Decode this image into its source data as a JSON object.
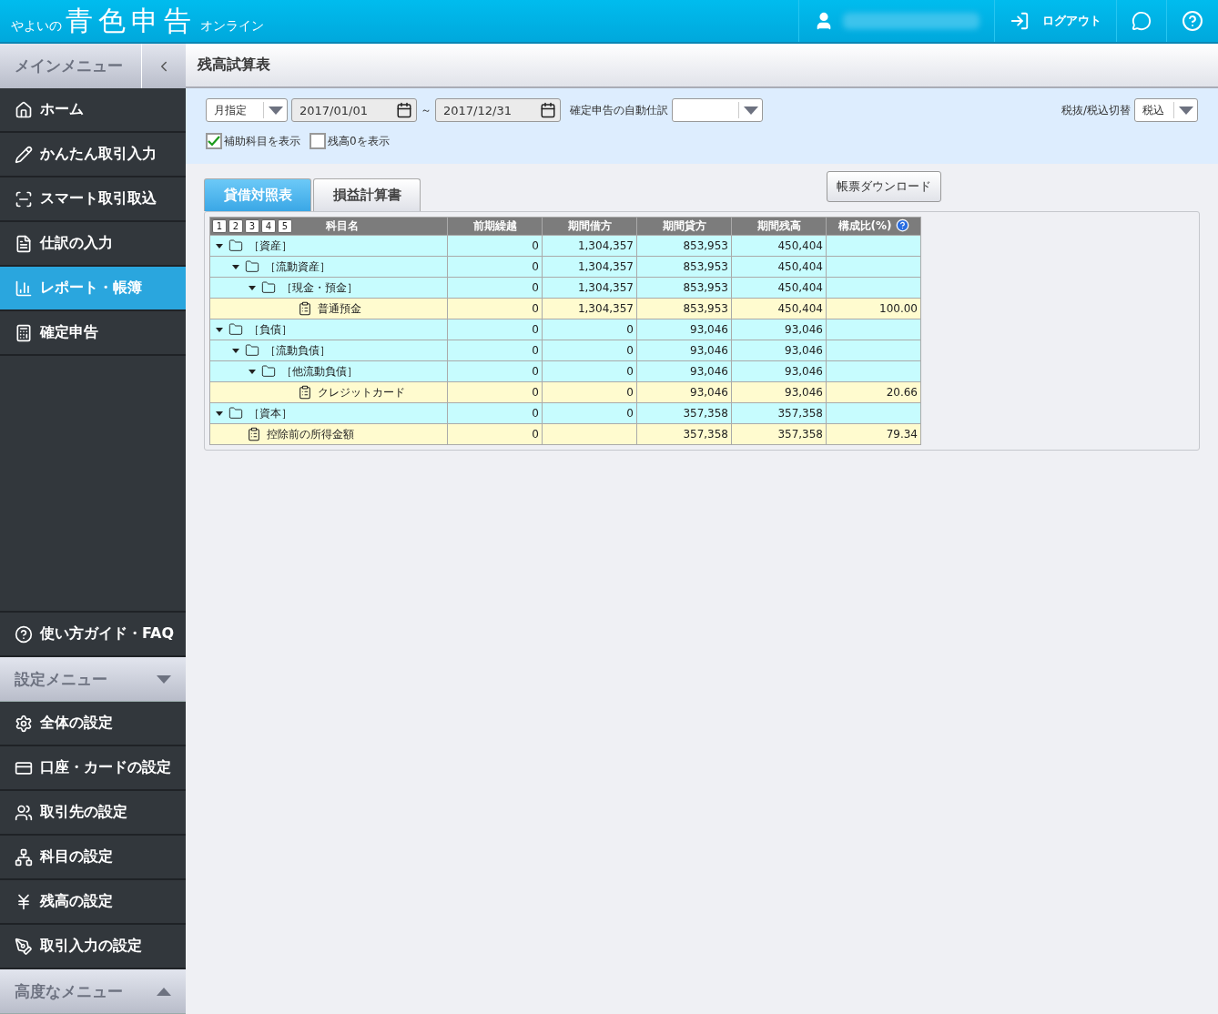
{
  "header": {
    "logo": {
      "prefix": "やよいの",
      "main": "青色申告",
      "suffix": "オンライン"
    },
    "logout": "ログアウト"
  },
  "sidebar": {
    "main_menu": {
      "title": "メインメニュー"
    },
    "items": [
      {
        "label": "ホーム",
        "selected": false
      },
      {
        "label": "かんたん取引入力",
        "selected": false
      },
      {
        "label": "スマート取引取込",
        "selected": false
      },
      {
        "label": "仕訳の入力",
        "selected": false
      },
      {
        "label": "レポート・帳簿",
        "selected": true
      },
      {
        "label": "確定申告",
        "selected": false
      }
    ],
    "guide": "使い方ガイド・FAQ",
    "settings_menu": {
      "title": "設定メニュー",
      "expanded": true,
      "items": [
        "全体の設定",
        "口座・カードの設定",
        "取引先の設定",
        "科目の設定",
        "残高の設定",
        "取引入力の設定"
      ]
    },
    "advanced_menu": {
      "title": "高度なメニュー",
      "expanded": false
    }
  },
  "page_title": "残高試算表",
  "filters": {
    "period_mode": "月指定",
    "date_from": "2017/01/01",
    "range_sep": "～",
    "date_to": "2017/12/31",
    "auto_journal_label": "確定申告の自動仕訳",
    "tax_label": "税抜/税込切替",
    "tax_mode": "税込",
    "checkboxes": [
      {
        "label": "補助科目を表示",
        "checked": true
      },
      {
        "label": "残高0を表示",
        "checked": false
      }
    ]
  },
  "tabs": [
    {
      "label": "貸借対照表",
      "selected": true
    },
    {
      "label": "損益計算書",
      "selected": false
    }
  ],
  "download_button": "帳票ダウンロード",
  "table": {
    "level_buttons": [
      "1",
      "2",
      "3",
      "4",
      "5"
    ],
    "columns": [
      "科目名",
      "前期繰越",
      "期間借方",
      "期間貸方",
      "期間残高",
      "構成比(%)"
    ],
    "rows": [
      {
        "kind": "folder",
        "name": "［資産］",
        "expanded": true,
        "values": [
          "0",
          "1,304,357",
          "853,953",
          "450,404"
        ],
        "children": [
          {
            "kind": "folder",
            "name": "［流動資産］",
            "expanded": true,
            "values": [
              "0",
              "1,304,357",
              "853,953",
              "450,404"
            ],
            "children": [
              {
                "kind": "folder",
                "name": "［現金・預金］",
                "expanded": true,
                "values": [
                  "0",
                  "1,304,357",
                  "853,953",
                  "450,404"
                ],
                "children": [
                  {
                    "kind": "account",
                    "name": "普通預金",
                    "values": [
                      "0",
                      "1,304,357",
                      "853,953",
                      "450,404",
                      "100.00"
                    ]
                  }
                ]
              }
            ]
          }
        ]
      },
      {
        "kind": "folder",
        "name": "［負債］",
        "expanded": true,
        "values": [
          "0",
          "0",
          "93,046",
          "93,046"
        ],
        "children": [
          {
            "kind": "folder",
            "name": "［流動負債］",
            "expanded": true,
            "values": [
              "0",
              "0",
              "93,046",
              "93,046"
            ],
            "children": [
              {
                "kind": "folder",
                "name": "［他流動負債］",
                "expanded": true,
                "values": [
                  "0",
                  "0",
                  "93,046",
                  "93,046"
                ],
                "children": [
                  {
                    "kind": "account",
                    "name": "クレジットカード",
                    "values": [
                      "0",
                      "0",
                      "93,046",
                      "93,046",
                      "20.66"
                    ]
                  }
                ]
              }
            ]
          }
        ]
      },
      {
        "kind": "folder",
        "name": "［資本］",
        "expanded": true,
        "values": [
          "0",
          "0",
          "357,358",
          "357,358"
        ]
      },
      {
        "kind": "account",
        "name": "控除前の所得金額",
        "values": [
          "0"
        ],
        "values_after_gap": [
          "357,358",
          "357,358",
          "79.34"
        ]
      }
    ]
  }
}
